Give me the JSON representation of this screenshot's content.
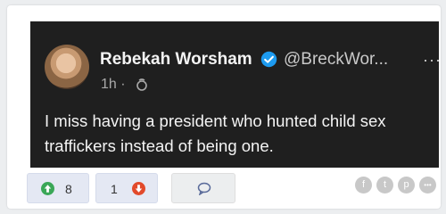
{
  "tweet": {
    "author_name": "Rebekah Worsham",
    "handle": "@BreckWor...",
    "time": "1h ·",
    "more": "···",
    "text": "I miss having a president who hunted child sex traffickers instead of being one.",
    "verified_icon": "verified-badge-icon",
    "visibility_icon": "globe-icon"
  },
  "actions": {
    "upvotes": "8",
    "downvotes": "1",
    "share_icons": [
      "facebook-icon",
      "twitter-icon",
      "pinterest-icon",
      "more-share-icon"
    ],
    "share_glyphs": [
      "f",
      "t",
      "p",
      "•••"
    ]
  },
  "colors": {
    "tweet_bg": "#1f1f1f",
    "upvote_green": "#3aa757",
    "downvote_red": "#e24a2b",
    "verified_blue": "#1d9bf0"
  }
}
